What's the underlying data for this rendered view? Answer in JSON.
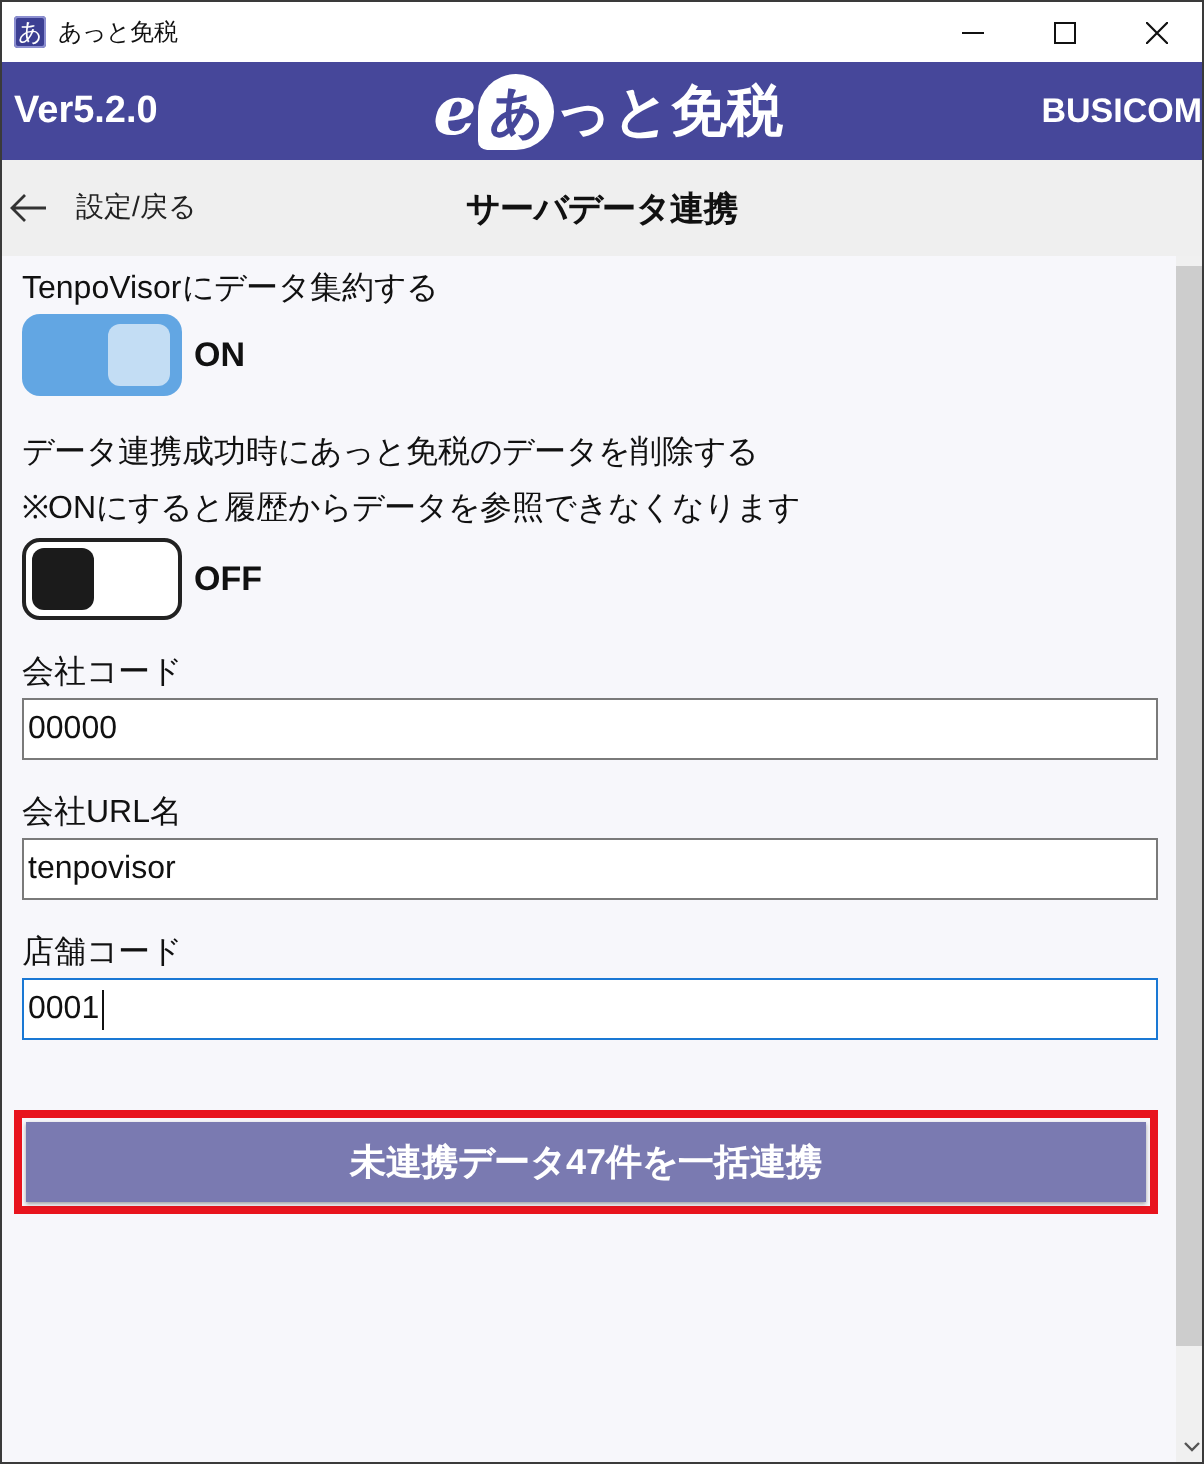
{
  "window": {
    "title": "あっと免税",
    "icon_glyph": "あ"
  },
  "header": {
    "version": "Ver5.2.0",
    "logo": {
      "mark": "e",
      "bubble": "あ",
      "rest": "っと免税"
    },
    "brand": "BUSICOM"
  },
  "nav": {
    "back_label": "設定/戻る",
    "title": "サーバデータ連携"
  },
  "settings": [
    {
      "kind": "toggle",
      "label": "TenpoVisorにデータ集約する",
      "on": true,
      "state_label": "ON"
    },
    {
      "kind": "toggle",
      "label": "データ連携成功時にあっと免税のデータを削除する",
      "note": "※ONにすると履歴からデータを参照できなくなります",
      "on": false,
      "state_label": "OFF"
    },
    {
      "kind": "field",
      "label": "会社コード",
      "value": "00000",
      "focused": false
    },
    {
      "kind": "field",
      "label": "会社URL名",
      "value": "tenpovisor",
      "focused": false
    },
    {
      "kind": "field",
      "label": "店舗コード",
      "value": "0001",
      "focused": true
    }
  ],
  "action_button": {
    "label": "未連携データ47件を一括連携",
    "highlighted": true
  }
}
